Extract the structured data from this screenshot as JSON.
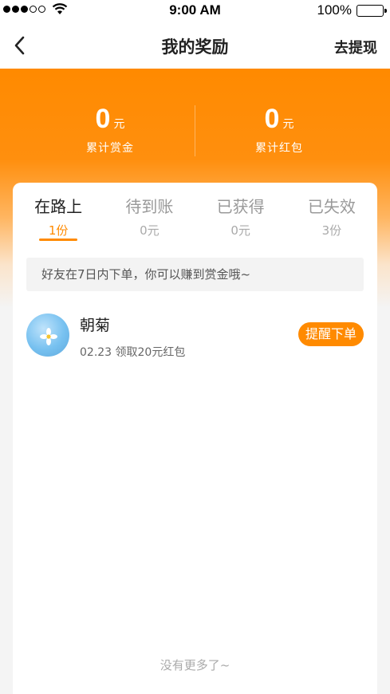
{
  "status_bar": {
    "time": "9:00 AM",
    "battery": "100%"
  },
  "nav": {
    "title": "我的奖励",
    "action": "去提现",
    "back_icon": "chevron-left-icon"
  },
  "summary": {
    "bounty": {
      "value": "0",
      "unit": "元",
      "label": "累计赏金"
    },
    "red_packet": {
      "value": "0",
      "unit": "元",
      "label": "累计红包"
    }
  },
  "tabs": [
    {
      "label": "在路上",
      "count": "1份",
      "active": true
    },
    {
      "label": "待到账",
      "count": "0元",
      "active": false
    },
    {
      "label": "已获得",
      "count": "0元",
      "active": false
    },
    {
      "label": "已失效",
      "count": "3份",
      "active": false
    }
  ],
  "notice": "好友在7日内下单，你可以赚到赏金哦~",
  "rewards": [
    {
      "name": "朝菊",
      "meta": "02.23 领取20元红包",
      "action": "提醒下单"
    }
  ],
  "footer": "没有更多了~",
  "colors": {
    "accent": "#ff8a00",
    "background": "#f4f4f4"
  }
}
